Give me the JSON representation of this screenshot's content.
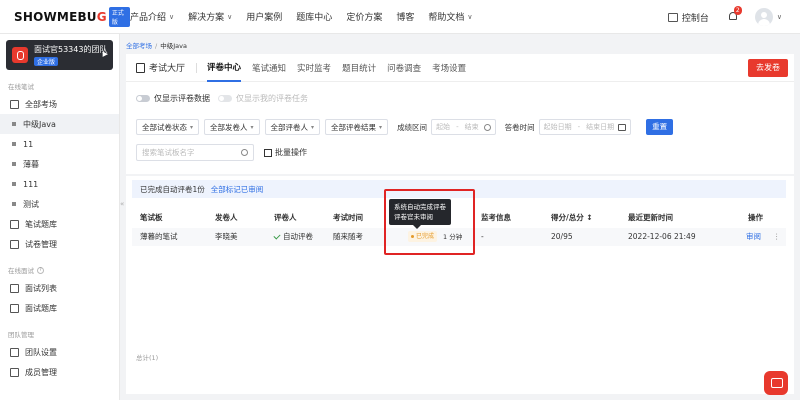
{
  "logo": {
    "text_before": "SHOWMEBU",
    "text_accent": "G",
    "badge": "正式版"
  },
  "topnav": {
    "items": [
      {
        "label": "产品介绍",
        "has_menu": true
      },
      {
        "label": "解决方案",
        "has_menu": true
      },
      {
        "label": "用户案例",
        "has_menu": false
      },
      {
        "label": "题库中心",
        "has_menu": false
      },
      {
        "label": "定价方案",
        "has_menu": false
      },
      {
        "label": "博客",
        "has_menu": false
      },
      {
        "label": "帮助文档",
        "has_menu": true
      }
    ],
    "menu_chevron": "∨",
    "console_label": "控制台",
    "notification_count": "2"
  },
  "sidebar": {
    "team_name": "面试官53343的团队",
    "team_badge": "企业版",
    "arrow": "▶",
    "group_written": "在线笔试",
    "item_all_venues": "全部考场",
    "sub_items": [
      "中级Java",
      "11",
      "薄暮",
      "111",
      "测试"
    ],
    "item_written_bank": "笔试题库",
    "item_paper_mgmt": "试卷管理",
    "group_interview": "在线面试",
    "item_interview_list": "面试列表",
    "item_interview_bank": "面试题库",
    "group_team": "团队管理",
    "item_team_settings": "团队设置",
    "item_members": "成员管理",
    "collapse": "«"
  },
  "breadcrumb": {
    "root": "全部考场",
    "sep": "/",
    "current": "中级Java"
  },
  "tabs": {
    "hall": "考试大厅",
    "items": [
      "评卷中心",
      "笔试通知",
      "实时监考",
      "题目统计",
      "问卷调查",
      "考场设置"
    ],
    "send_button": "去发卷"
  },
  "filters": {
    "toggle_show_data": "仅显示评卷数据",
    "toggle_my_tasks": "仅显示我的评卷任务",
    "selects": [
      "全部试卷状态",
      "全部发卷人",
      "全部评卷人",
      "全部评卷结果"
    ],
    "chevron": "▾",
    "score_range_label": "成绩区间",
    "range_start": "起始",
    "range_end": "结束",
    "range_dash": "-",
    "date_label": "答卷时间",
    "date_start": "起始日期",
    "date_end": "结束日期",
    "reset_button": "重置",
    "search_placeholder": "搜索笔试板名字",
    "batch_button": "批量操作"
  },
  "notice": {
    "text": "已完成自动评卷1份",
    "link": "全部标记已审阅"
  },
  "table": {
    "headers": [
      "笔试板",
      "发卷人",
      "评卷人",
      "考试时间",
      "监考信息",
      "得分/总分 ↕",
      "最近更新时间",
      "操作"
    ],
    "row": {
      "paper": "薄暮的笔试",
      "sender": "李晓美",
      "grader": "自动评卷",
      "exam_type": "随来随考",
      "status": "已完成",
      "duration": "1 分钟",
      "proctor": "-",
      "score": "20/95",
      "updated": "2022-12-06 21:49",
      "action": "审阅",
      "more": "⋮"
    }
  },
  "tooltip": {
    "line1": "系统自动完成评卷",
    "line2": "评卷官未审阅"
  },
  "total": "总计(1)",
  "colors": {
    "accent": "#2f6fe4",
    "brand": "#e8392d",
    "highlight": "#e02424",
    "status": "#e49a2a"
  }
}
